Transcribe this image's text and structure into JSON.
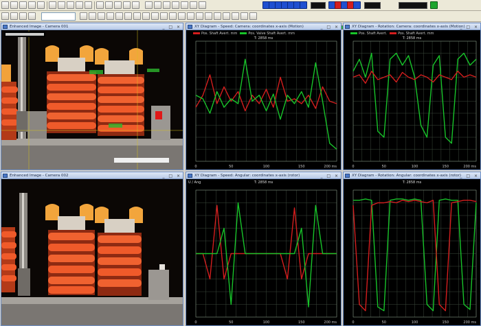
{
  "colors": {
    "red_trace": "#d41e1e",
    "green_trace": "#18c42a",
    "grid": "#3c4a3c",
    "title_bg": "#c6d6f0"
  },
  "toolbar": {
    "row1_icons": [
      "new-icon",
      "open-icon",
      "save-icon",
      "print-icon",
      "cut-icon",
      "copy-icon",
      "paste-icon",
      "undo-icon",
      "redo-icon",
      "zoom-icon",
      "cursor-icon",
      "measure-icon",
      "record-icon",
      "play-icon",
      "stop-icon"
    ],
    "transport_icons": [
      "first-frame-icon",
      "prev-frame-icon",
      "play-reverse-icon",
      "play-icon",
      "next-frame-icon",
      "last-frame-icon",
      "loop-icon"
    ],
    "row2_combo": "",
    "slider_level": 0.74
  },
  "panels": {
    "cam_top": {
      "title": "Enhanced Image - Camera 001",
      "label": ""
    },
    "cam_bottom": {
      "title": "Enhanced Image - Camera 002"
    },
    "graph_tr1": {
      "title": "XY Diagram - Speed: Camera: coordinates x-axis (Motion)",
      "legend": [
        {
          "name": "Pos. Shaft Avert. mm",
          "color": "#d41e1e"
        },
        {
          "name": "Pos. Valve Shaft Avert. mm",
          "color": "#18c42a"
        }
      ],
      "heading": "T: 2858 ms",
      "ylabel": "",
      "x_ticks": [
        "0",
        "50",
        "100",
        "150",
        "200 ms"
      ]
    },
    "graph_tr2": {
      "title": "XY Diagram - Rotation: Camera: coordinates x-axis (Motion)",
      "legend": [
        {
          "name": "Pos. Shaft Avert.",
          "color": "#18c42a"
        },
        {
          "name": "Pos. Shaft Avert. mm",
          "color": "#d41e1e"
        }
      ],
      "heading": "T: 2858 ms",
      "ylabel": "",
      "x_ticks": [
        "0",
        "50",
        "100",
        "150",
        "200 ms"
      ]
    },
    "graph_br1": {
      "title": "XY Diagram - Speed: Angular: coordinates x-axis (rotor)",
      "legend": [],
      "heading": "T: 2858 ms",
      "ylabel": "U / Ang",
      "x_ticks": [
        "0",
        "50",
        "100",
        "150",
        "200 ms"
      ]
    },
    "graph_br2": {
      "title": "XY Diagram - Rotation: Angular: coordinates x-axis (rotor)",
      "legend": [],
      "heading": "T: 2858 ms",
      "ylabel": "",
      "x_ticks": [
        "0",
        "50",
        "100",
        "150",
        "200 ms"
      ]
    }
  },
  "chart_data": [
    {
      "type": "line",
      "panel": "graph_tr1",
      "x": [
        0,
        10,
        20,
        30,
        40,
        50,
        60,
        70,
        80,
        90,
        100,
        110,
        120,
        130,
        140,
        150,
        160,
        170,
        180,
        190,
        200
      ],
      "series": [
        {
          "name": "Pos. Shaft Avert. mm",
          "color": "#d41e1e",
          "values": [
            0.45,
            0.55,
            0.72,
            0.48,
            0.62,
            0.5,
            0.58,
            0.42,
            0.55,
            0.48,
            0.6,
            0.45,
            0.7,
            0.5,
            0.52,
            0.48,
            0.55,
            0.44,
            0.62,
            0.5,
            0.48
          ]
        },
        {
          "name": "Pos. Valve Shaft Avert. mm",
          "color": "#18c42a",
          "values": [
            0.55,
            0.52,
            0.4,
            0.58,
            0.45,
            0.52,
            0.48,
            0.85,
            0.5,
            0.55,
            0.42,
            0.56,
            0.35,
            0.55,
            0.48,
            0.58,
            0.45,
            0.82,
            0.5,
            0.15,
            0.1
          ]
        }
      ],
      "ylim": [
        0,
        1
      ]
    },
    {
      "type": "line",
      "panel": "graph_tr2",
      "x": [
        0,
        10,
        20,
        30,
        40,
        50,
        60,
        70,
        80,
        90,
        100,
        110,
        120,
        130,
        140,
        150,
        160,
        170,
        180,
        190,
        200
      ],
      "series": [
        {
          "name": "Pos. Shaft Avert.",
          "color": "#18c42a",
          "values": [
            0.75,
            0.85,
            0.7,
            0.9,
            0.25,
            0.2,
            0.85,
            0.9,
            0.8,
            0.88,
            0.7,
            0.3,
            0.2,
            0.8,
            0.88,
            0.2,
            0.15,
            0.85,
            0.9,
            0.8,
            0.85
          ]
        },
        {
          "name": "Pos. Shaft Avert. mm",
          "color": "#d41e1e",
          "values": [
            0.7,
            0.72,
            0.65,
            0.75,
            0.68,
            0.7,
            0.72,
            0.66,
            0.74,
            0.7,
            0.68,
            0.72,
            0.7,
            0.66,
            0.72,
            0.7,
            0.68,
            0.75,
            0.7,
            0.72,
            0.7
          ]
        }
      ],
      "ylim": [
        0,
        1
      ]
    },
    {
      "type": "line",
      "panel": "graph_br1",
      "x": [
        0,
        10,
        20,
        30,
        40,
        50,
        60,
        70,
        80,
        90,
        100,
        110,
        120,
        130,
        140,
        150,
        160,
        170,
        180,
        190,
        200
      ],
      "series": [
        {
          "name": "series-red",
          "color": "#d41e1e",
          "values": [
            0.5,
            0.5,
            0.3,
            0.88,
            0.3,
            0.5,
            0.5,
            0.5,
            0.5,
            0.5,
            0.5,
            0.5,
            0.5,
            0.3,
            0.86,
            0.3,
            0.5,
            0.5,
            0.5,
            0.5,
            0.5
          ]
        },
        {
          "name": "series-green",
          "color": "#18c42a",
          "values": [
            0.5,
            0.5,
            0.5,
            0.5,
            0.7,
            0.1,
            0.9,
            0.5,
            0.5,
            0.5,
            0.5,
            0.5,
            0.5,
            0.5,
            0.5,
            0.7,
            0.08,
            0.88,
            0.5,
            0.5,
            0.5
          ]
        }
      ],
      "ylim": [
        0,
        1
      ]
    },
    {
      "type": "line",
      "panel": "graph_br2",
      "x": [
        0,
        10,
        20,
        30,
        40,
        50,
        60,
        70,
        80,
        90,
        100,
        110,
        120,
        130,
        140,
        150,
        160,
        170,
        180,
        190,
        200
      ],
      "series": [
        {
          "name": "series-green",
          "color": "#18c42a",
          "values": [
            0.92,
            0.92,
            0.93,
            0.92,
            0.08,
            0.05,
            0.92,
            0.93,
            0.93,
            0.92,
            0.93,
            0.92,
            0.1,
            0.05,
            0.92,
            0.93,
            0.92,
            0.92,
            0.1,
            0.06,
            0.9
          ]
        },
        {
          "name": "series-red",
          "color": "#d41e1e",
          "values": [
            0.88,
            0.1,
            0.05,
            0.88,
            0.9,
            0.9,
            0.91,
            0.9,
            0.92,
            0.91,
            0.92,
            0.91,
            0.9,
            0.92,
            0.1,
            0.05,
            0.9,
            0.91,
            0.92,
            0.92,
            0.91
          ]
        }
      ],
      "ylim": [
        0,
        1
      ]
    }
  ]
}
